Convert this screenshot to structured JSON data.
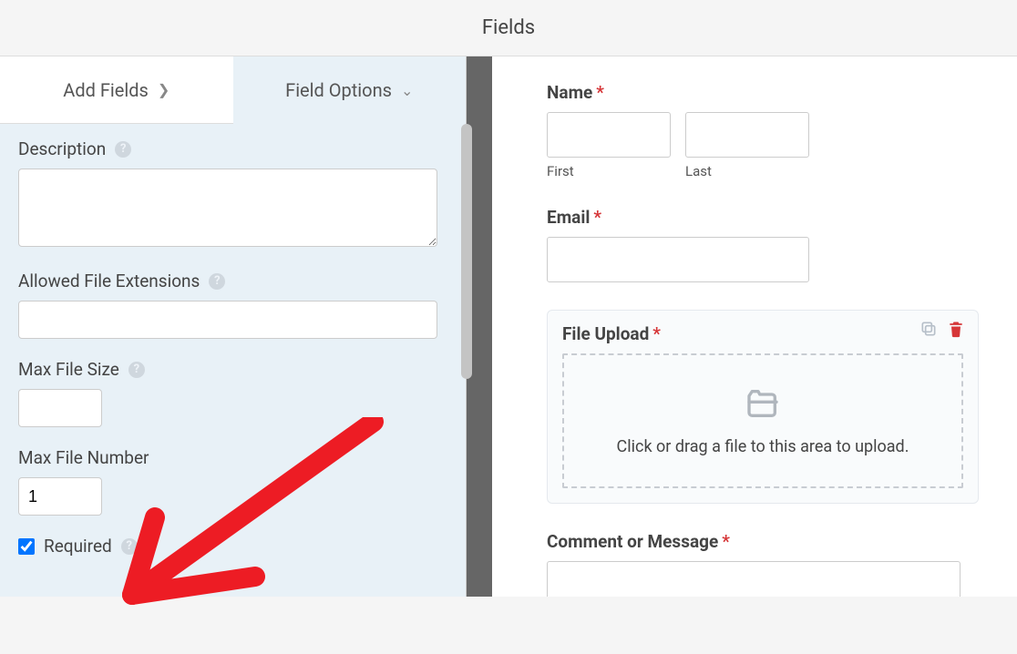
{
  "header": {
    "title": "Fields"
  },
  "tabs": {
    "add": "Add Fields",
    "options": "Field Options"
  },
  "sidebar": {
    "description_label": "Description",
    "description_value": "",
    "allowed_ext_label": "Allowed File Extensions",
    "allowed_ext_value": "",
    "max_size_label": "Max File Size",
    "max_size_value": "",
    "max_number_label": "Max File Number",
    "max_number_value": "1",
    "required_label": "Required"
  },
  "preview": {
    "name": {
      "label": "Name",
      "first": "First",
      "last": "Last"
    },
    "email": {
      "label": "Email"
    },
    "upload": {
      "label": "File Upload",
      "hint": "Click or drag a file to this area to upload."
    },
    "comment": {
      "label": "Comment or Message"
    }
  }
}
